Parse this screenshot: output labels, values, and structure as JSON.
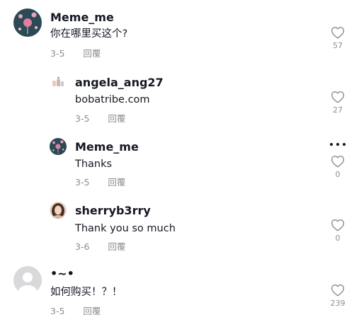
{
  "comments": [
    {
      "username": "Meme_me",
      "text": "你在哪里买这个?",
      "date": "3-5",
      "reply_label": "回覆",
      "likes": "57",
      "avatar": "balloon-avatar"
    },
    {
      "username": "angela_ang27",
      "text": "bobatribe.com",
      "date": "3-5",
      "reply_label": "回覆",
      "likes": "27",
      "avatar": "drink-avatar"
    },
    {
      "username": "Meme_me",
      "text": "Thanks",
      "date": "3-5",
      "reply_label": "回覆",
      "likes": "0",
      "avatar": "balloon-avatar"
    },
    {
      "username": "sherryb3rry",
      "text": "Thank you so much",
      "date": "3-6",
      "reply_label": "回覆",
      "likes": "0",
      "avatar": "photo-avatar"
    },
    {
      "username": "•~•",
      "text": "如何购买！？！",
      "date": "3-5",
      "reply_label": "回覆",
      "likes": "239",
      "avatar": "default-avatar"
    }
  ],
  "icons": {
    "like": "heart-outline-icon",
    "more": "more-horizontal-icon"
  },
  "colors": {
    "text": "#161823",
    "secondary": "#8a8b91",
    "avatar_bg": "#2b4a55",
    "default_avatar": "#d9d9db"
  }
}
